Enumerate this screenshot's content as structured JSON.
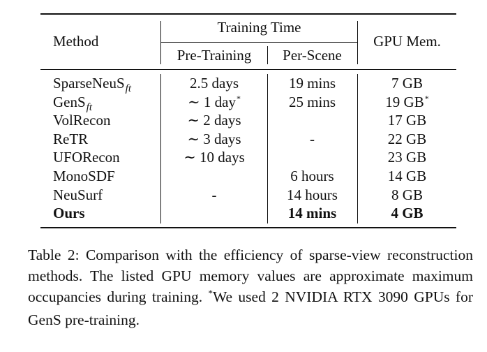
{
  "table": {
    "headers": {
      "method": "Method",
      "training_time": "Training Time",
      "pre_training": "Pre-Training",
      "per_scene": "Per-Scene",
      "gpu_mem": "GPU Mem."
    },
    "rows": [
      {
        "method": "SparseNeuS",
        "method_sub": "ft",
        "method_sup": "",
        "pre": "2.5 days",
        "pre_sup": "",
        "per": "19 mins",
        "gpu": "7 GB",
        "gpu_sup": "",
        "bold": false
      },
      {
        "method": "GenS",
        "method_sub": "ft",
        "method_sup": "",
        "pre": "∼ 1 day",
        "pre_sup": "*",
        "per": "25 mins",
        "gpu": "19 GB",
        "gpu_sup": "*",
        "bold": false
      },
      {
        "method": "VolRecon",
        "method_sub": "",
        "method_sup": "",
        "pre": "∼ 2 days",
        "pre_sup": "",
        "per": "",
        "gpu": "17 GB",
        "gpu_sup": "",
        "bold": false
      },
      {
        "method": "ReTR",
        "method_sub": "",
        "method_sup": "",
        "pre": "∼ 3 days",
        "pre_sup": "",
        "per": "-",
        "gpu": "22 GB",
        "gpu_sup": "",
        "bold": false
      },
      {
        "method": "UFORecon",
        "method_sub": "",
        "method_sup": "",
        "pre": "∼ 10 days",
        "pre_sup": "",
        "per": "",
        "gpu": "23 GB",
        "gpu_sup": "",
        "bold": false
      },
      {
        "method": "MonoSDF",
        "method_sub": "",
        "method_sup": "",
        "pre": "",
        "pre_sup": "",
        "per": "6 hours",
        "gpu": "14 GB",
        "gpu_sup": "",
        "bold": false
      },
      {
        "method": "NeuSurf",
        "method_sub": "",
        "method_sup": "",
        "pre": "-",
        "pre_sup": "",
        "per": "14 hours",
        "gpu": "8 GB",
        "gpu_sup": "",
        "bold": false
      },
      {
        "method": "Ours",
        "method_sub": "",
        "method_sup": "",
        "pre": "",
        "pre_sup": "",
        "per": "14 mins",
        "gpu": "4 GB",
        "gpu_sup": "",
        "bold": true
      }
    ]
  },
  "caption": {
    "lead": "Table 2: Comparison with the efficiency of sparse-view reconstruction methods. The listed GPU memory values are approximate maximum occupancies during training. ",
    "star": "*",
    "tail": "We used 2 NVIDIA RTX 3090 GPUs for GenS pre-training."
  }
}
